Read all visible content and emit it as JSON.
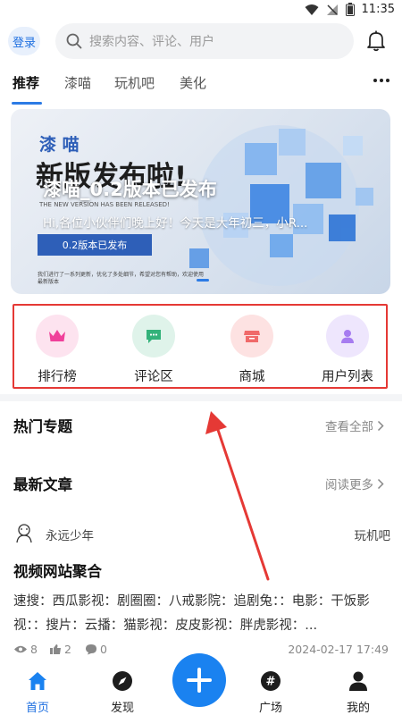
{
  "status_bar": {
    "time": "11:35"
  },
  "header": {
    "login_label": "登录",
    "search_placeholder": "搜索内容、评论、用户"
  },
  "tabs": [
    {
      "label": "推荐",
      "active": true
    },
    {
      "label": "漆喵",
      "active": false
    },
    {
      "label": "玩机吧",
      "active": false
    },
    {
      "label": "美化",
      "active": false
    }
  ],
  "banner": {
    "title": "漆喵_0.2版本已发布",
    "subtitle": "Hi,各位小伙伴们晚上好！今天是大年初三，小R...",
    "image_brand": "漆 喵",
    "image_headline": "新版发布啦!",
    "image_tagline": "THE NEW VERSION HAS BEEN RELEASED!",
    "image_button": "0.2版本已发布",
    "image_small_text": "我们进行了一系列更新，优化了多处细节，希望对您有帮助，欢迎使用最新版本"
  },
  "quick_access": [
    {
      "label": "排行榜",
      "icon": "crown-icon",
      "bg": "#fde3ef",
      "fg": "#f0409a"
    },
    {
      "label": "评论区",
      "icon": "chat-icon",
      "bg": "#dff3ea",
      "fg": "#33b27a"
    },
    {
      "label": "商城",
      "icon": "shop-icon",
      "bg": "#fde2e2",
      "fg": "#f06a6a"
    },
    {
      "label": "用户列表",
      "icon": "user-icon",
      "bg": "#eee6fd",
      "fg": "#a67cf0"
    }
  ],
  "hot_topics": {
    "title": "热门专题",
    "link": "查看全部"
  },
  "latest": {
    "title": "最新文章",
    "link": "阅读更多"
  },
  "article": {
    "author": "永远少年",
    "tag": "玩机吧",
    "title": "视频网站聚合",
    "body": "速搜：西瓜影视：剧圈圈：八戒影院：追剧兔：：电影：干饭影视：：搜片：云播：猫影视：皮皮影视：胖虎影视：...",
    "views": "8",
    "likes": "2",
    "comments": "0",
    "date": "2024-02-17 17:49"
  },
  "bottom_nav": [
    {
      "label": "首页",
      "icon": "home-icon",
      "active": true
    },
    {
      "label": "发现",
      "icon": "compass-icon",
      "active": false
    },
    {
      "label": "广场",
      "icon": "hashtag-icon",
      "active": false
    },
    {
      "label": "我的",
      "icon": "profile-icon",
      "active": false
    }
  ],
  "colors": {
    "accent": "#1a82f0",
    "annotation": "#e53935"
  }
}
